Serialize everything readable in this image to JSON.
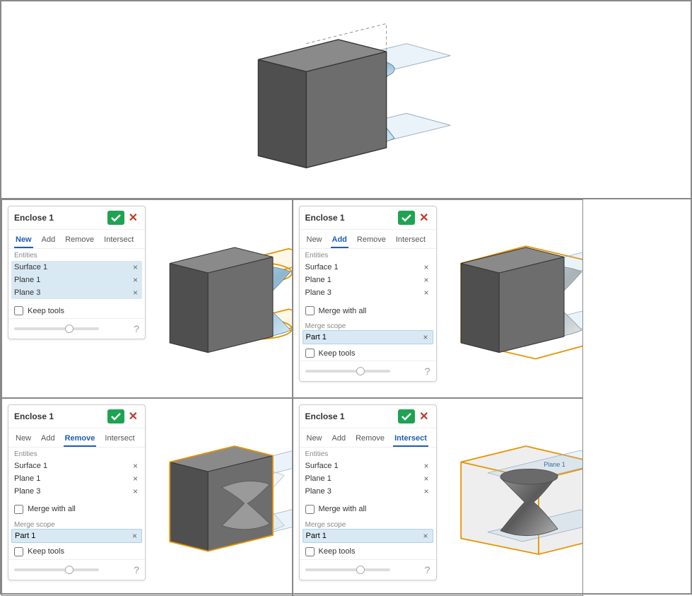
{
  "panels": {
    "new": {
      "title": "Enclose 1",
      "tabs": [
        "New",
        "Add",
        "Remove",
        "Intersect"
      ],
      "activeTab": "New",
      "entitiesLabel": "Entities",
      "entities": [
        "Surface 1",
        "Plane 1",
        "Plane 3"
      ],
      "entitiesHighlighted": true,
      "keepTools": "Keep tools"
    },
    "add": {
      "title": "Enclose 1",
      "tabs": [
        "New",
        "Add",
        "Remove",
        "Intersect"
      ],
      "activeTab": "Add",
      "entitiesLabel": "Entities",
      "entities": [
        "Surface 1",
        "Plane 1",
        "Plane 3"
      ],
      "mergeWithAll": "Merge with all",
      "mergeScopeLabel": "Merge scope",
      "mergeScope": "Part 1",
      "keepTools": "Keep tools"
    },
    "remove": {
      "title": "Enclose 1",
      "tabs": [
        "New",
        "Add",
        "Remove",
        "Intersect"
      ],
      "activeTab": "Remove",
      "entitiesLabel": "Entities",
      "entities": [
        "Surface 1",
        "Plane 1",
        "Plane 3"
      ],
      "mergeWithAll": "Merge with all",
      "mergeScopeLabel": "Merge scope",
      "mergeScope": "Part 1",
      "keepTools": "Keep tools"
    },
    "intersect": {
      "title": "Enclose 1",
      "tabs": [
        "New",
        "Add",
        "Remove",
        "Intersect"
      ],
      "activeTab": "Intersect",
      "entitiesLabel": "Entities",
      "entities": [
        "Surface 1",
        "Plane 1",
        "Plane 3"
      ],
      "mergeWithAll": "Merge with all",
      "mergeScopeLabel": "Merge scope",
      "mergeScope": "Part 1",
      "keepTools": "Keep tools",
      "planeLabel": "Plane 1"
    }
  }
}
